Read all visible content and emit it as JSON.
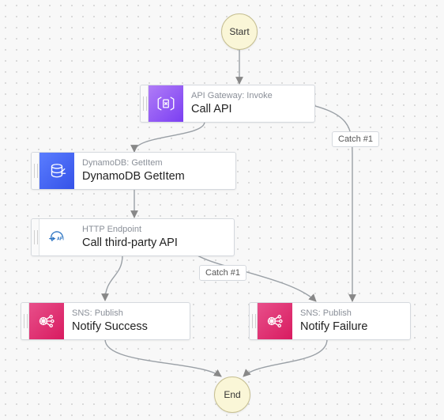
{
  "terminals": {
    "start": "Start",
    "end": "End"
  },
  "nodes": {
    "call_api": {
      "subtitle": "API Gateway: Invoke",
      "title": "Call API"
    },
    "ddb_getitem": {
      "subtitle": "DynamoDB: GetItem",
      "title": "DynamoDB GetItem"
    },
    "http_endpoint": {
      "subtitle": "HTTP Endpoint",
      "title": "Call third-party API"
    },
    "notify_success": {
      "subtitle": "SNS: Publish",
      "title": "Notify Success"
    },
    "notify_failure": {
      "subtitle": "SNS: Publish",
      "title": "Notify Failure"
    }
  },
  "edge_labels": {
    "catch1_top": "Catch #1",
    "catch1_mid": "Catch #1"
  }
}
